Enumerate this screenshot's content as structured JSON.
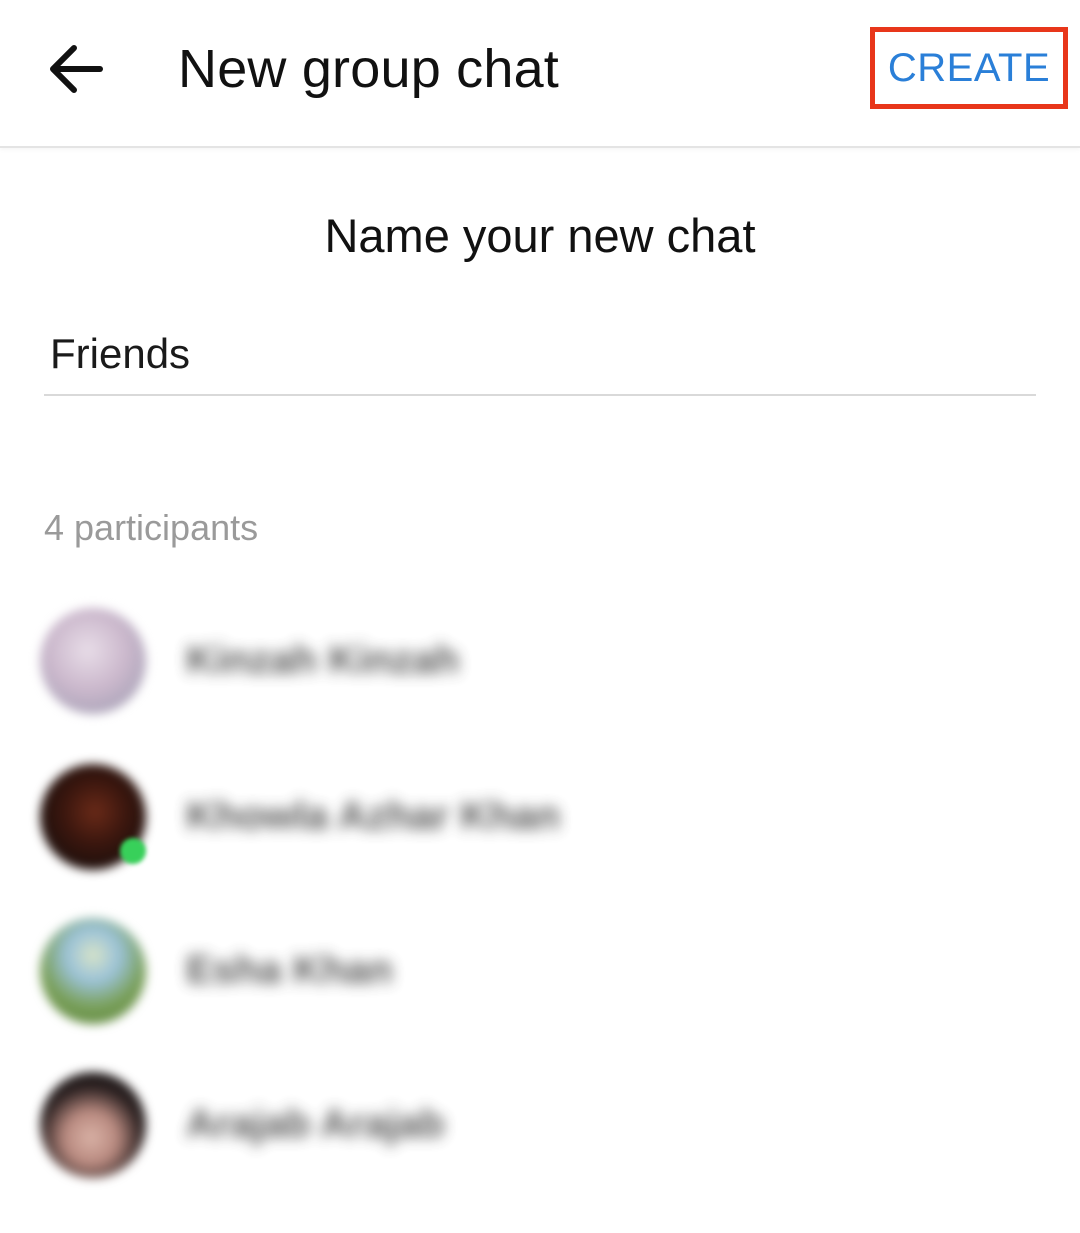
{
  "appbar": {
    "back_icon": "arrow-left-icon",
    "title": "New group chat",
    "create_label": "CREATE",
    "create_color": "#2a7fd8",
    "highlight_color": "#e8361a"
  },
  "main": {
    "heading": "Name your new chat",
    "name_input": {
      "value": "Friends",
      "placeholder": ""
    },
    "participants_label": "4 participants",
    "participants": [
      {
        "name": "Kinzah Kinzah",
        "online": false
      },
      {
        "name": "Khowla Azhar Khan",
        "online": true
      },
      {
        "name": "Esha Khan",
        "online": false
      },
      {
        "name": "Arajab Arajab",
        "online": false
      }
    ]
  }
}
